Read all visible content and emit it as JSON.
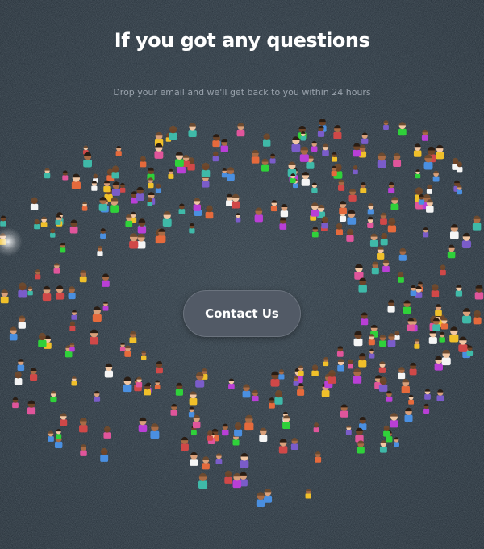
{
  "hero": {
    "title": "If you got any questions",
    "subtitle": "Drop your email and we'll get back to you within 24 hours",
    "cta_label": "Contact Us"
  },
  "colors": {
    "background": "#2b3640",
    "title": "#ffffff",
    "subtitle": "#9aa3ad",
    "button": "#525a66",
    "shirts": [
      "#e0559b",
      "#3fb9a8",
      "#f0c02a",
      "#7a5cc9",
      "#e56a3c",
      "#2fd13a",
      "#b93fd6",
      "#4a8fe0",
      "#f5f5f5",
      "#d04848"
    ],
    "skin": [
      "#f1c7a4",
      "#d9a07a",
      "#a86b45",
      "#6e4428"
    ]
  }
}
